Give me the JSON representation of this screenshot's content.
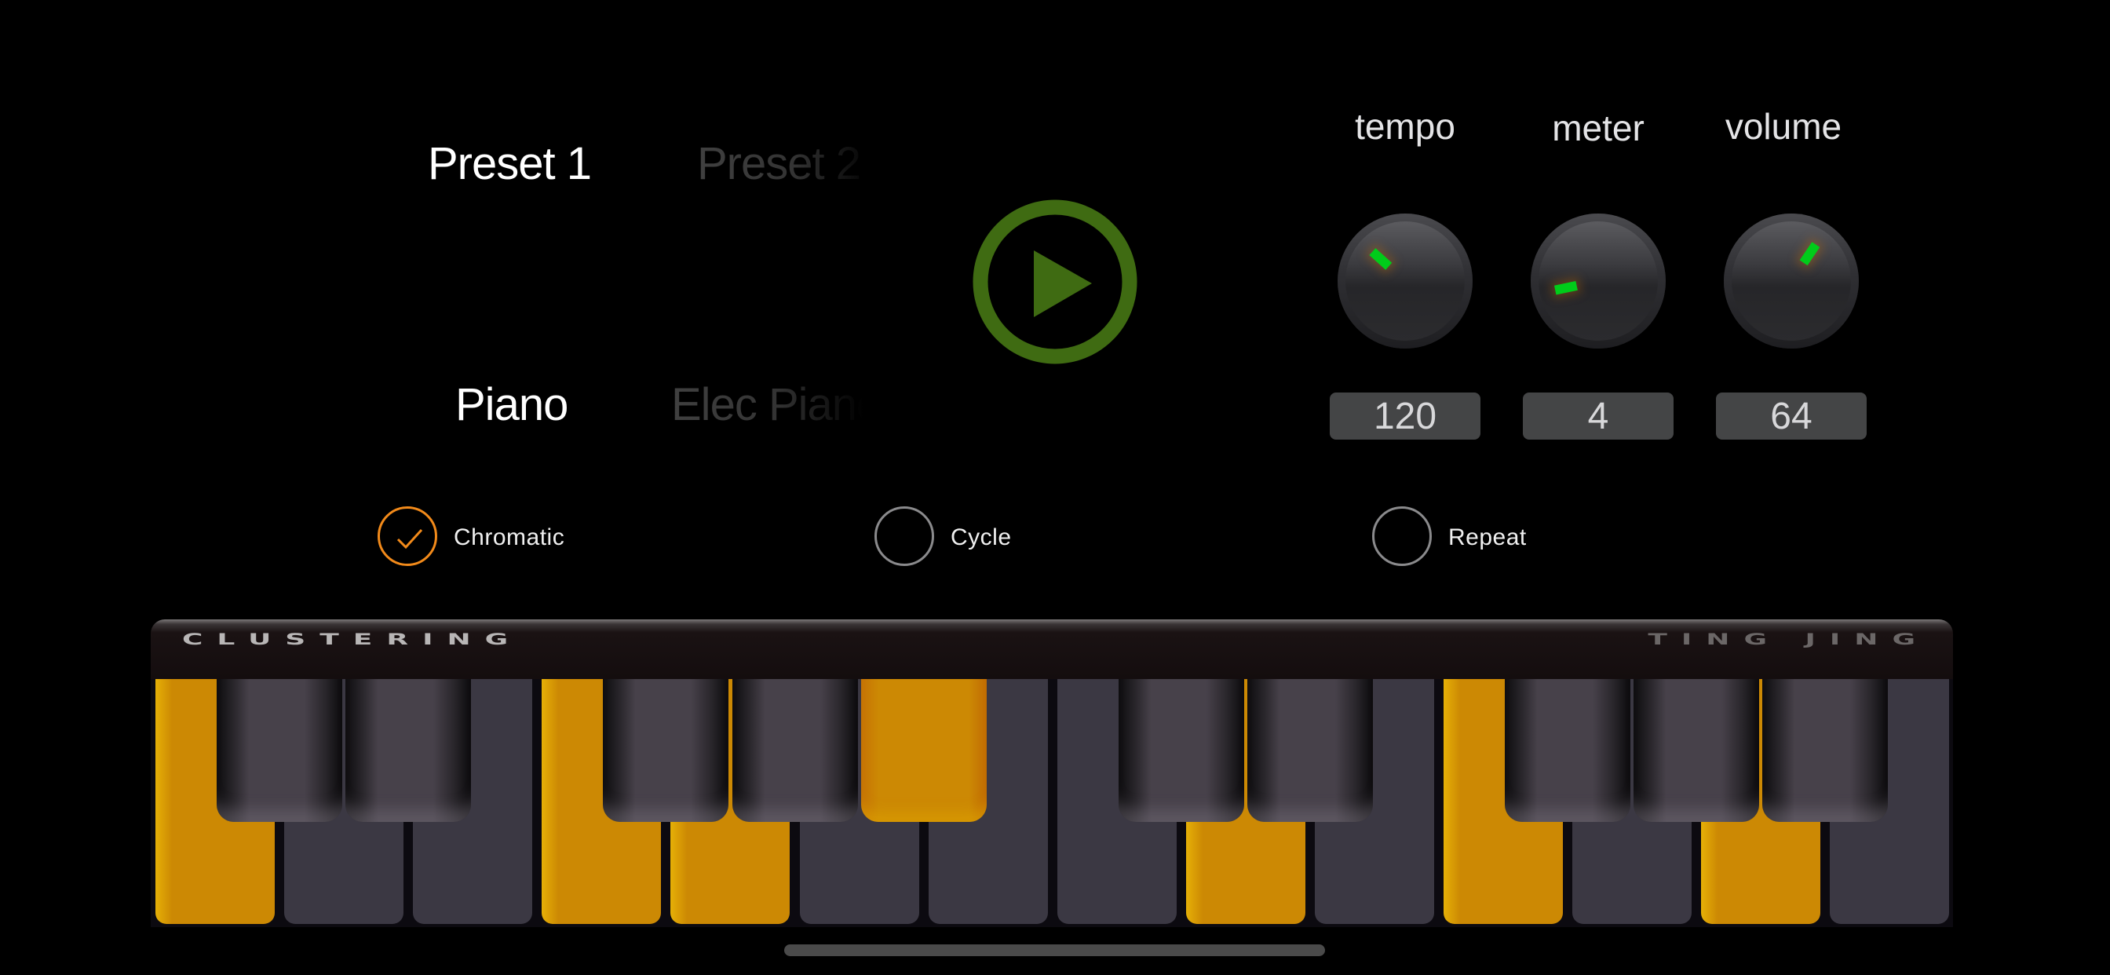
{
  "presets": {
    "items": [
      {
        "label": "Preset 1",
        "active": true
      },
      {
        "label": "Preset 2",
        "active": false
      }
    ]
  },
  "instruments": {
    "items": [
      {
        "label": "Piano",
        "active": true
      },
      {
        "label": "Elec Piano",
        "active": false
      }
    ]
  },
  "transport": {
    "play_icon": "play-circle-icon",
    "color": "#3f6b12"
  },
  "knobs": [
    {
      "label": "tempo",
      "value": "120",
      "pointer_angle_deg": -48
    },
    {
      "label": "meter",
      "value": "4",
      "pointer_angle_deg": -102
    },
    {
      "label": "volume",
      "value": "64",
      "pointer_angle_deg": 34
    }
  ],
  "options": [
    {
      "label": "Chromatic",
      "checked": true
    },
    {
      "label": "Cycle",
      "checked": false
    },
    {
      "label": "Repeat",
      "checked": false
    }
  ],
  "keyboard": {
    "brand_left": "CLUSTERING",
    "brand_right": "TING JING",
    "white_keys_lit": [
      true,
      false,
      false,
      true,
      true,
      false,
      false,
      false,
      true,
      false,
      true,
      false,
      true,
      false
    ],
    "black_keys_lit": [
      false,
      false,
      false,
      false,
      true,
      false,
      false,
      false,
      false,
      false
    ],
    "accent_color": "#cc8904",
    "check_color": "#f28a1a",
    "indicator_color": "#00cc1a"
  }
}
